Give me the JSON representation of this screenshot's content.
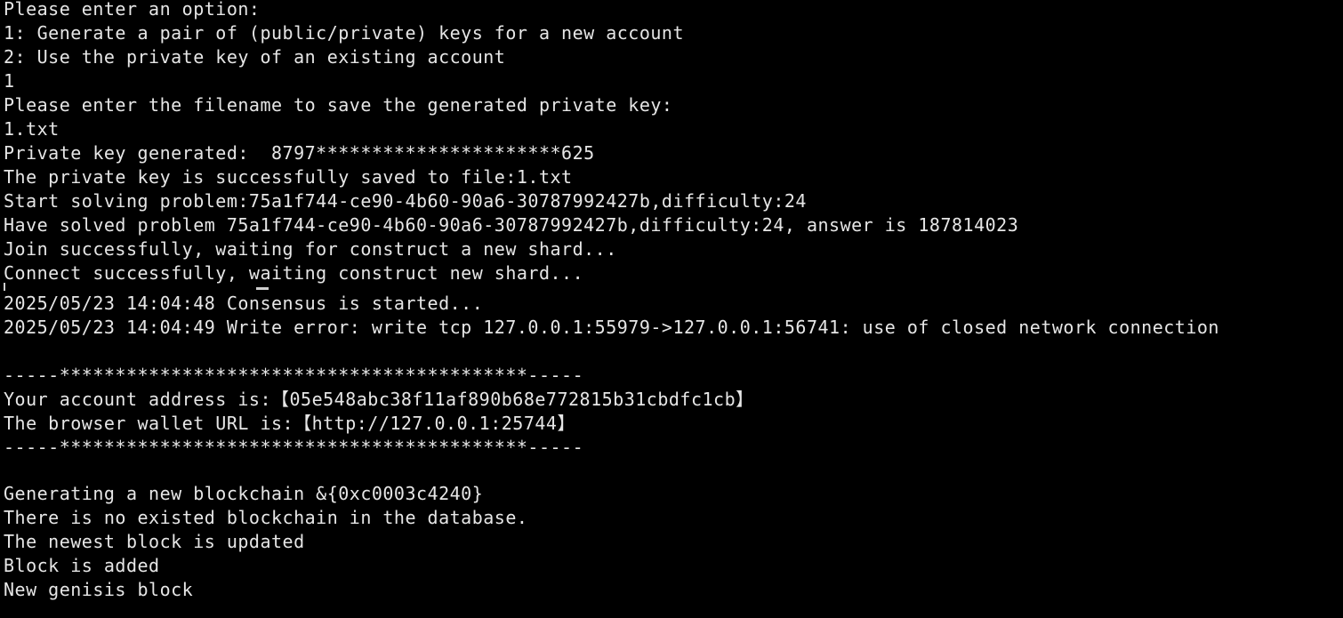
{
  "terminal": {
    "lines": [
      "Please enter an option:",
      "1: Generate a pair of (public/private) keys for a new account",
      "2: Use the private key of an existing account",
      "1",
      "Please enter the filename to save the generated private key:",
      "1.txt",
      "Private key generated:  8797**********************625",
      "The private key is successfully saved to file:1.txt",
      "Start solving problem:75a1f744-ce90-4b60-90a6-30787992427b,difficulty:24",
      "Have solved problem 75a1f744-ce90-4b60-90a6-30787992427b,difficulty:24, answer is 187814023",
      "Join successfully, waiting for construct a new shard...",
      "Connect successfully, waiting construct new shard...",
      "2025/05/23 14:04:48 Consensus is started...",
      "2025/05/23 14:04:49 Write error: write tcp 127.0.0.1:55979->127.0.0.1:56741: use of closed network connection",
      "",
      "-----******************************************-----",
      "Your account address is:【05e548abc38f11af890b68e772815b31cbdfc1cb】",
      "The browser wallet URL is:【http://127.0.0.1:25744】",
      "-----******************************************-----",
      "",
      "Generating a new blockchain &{0xc0003c4240}",
      "There is no existed blockchain in the database.",
      "The newest block is updated",
      "Block is added",
      "New genisis block"
    ]
  },
  "colors": {
    "background": "#000000",
    "text": "#e6e6e6"
  }
}
